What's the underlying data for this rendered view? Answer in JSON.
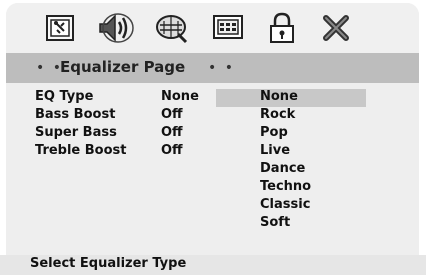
{
  "toolbar": {
    "icons": [
      "general-setup-icon",
      "audio-setup-icon",
      "video-setup-icon",
      "preference-icon",
      "password-lock-icon",
      "exit-icon"
    ]
  },
  "header": {
    "dots_left": "• •",
    "title": "Equalizer Page",
    "dots_right": "• •"
  },
  "settings": [
    {
      "label": "EQ Type",
      "value": "None"
    },
    {
      "label": "Bass Boost",
      "value": "Off"
    },
    {
      "label": "Super Bass",
      "value": "Off"
    },
    {
      "label": "Treble Boost",
      "value": "Off"
    }
  ],
  "options": [
    "None",
    "Rock",
    "Pop",
    "Live",
    "Dance",
    "Techno",
    "Classic",
    "Soft"
  ],
  "selected_option": "None",
  "footer": {
    "hint": "Select Equalizer Type"
  }
}
